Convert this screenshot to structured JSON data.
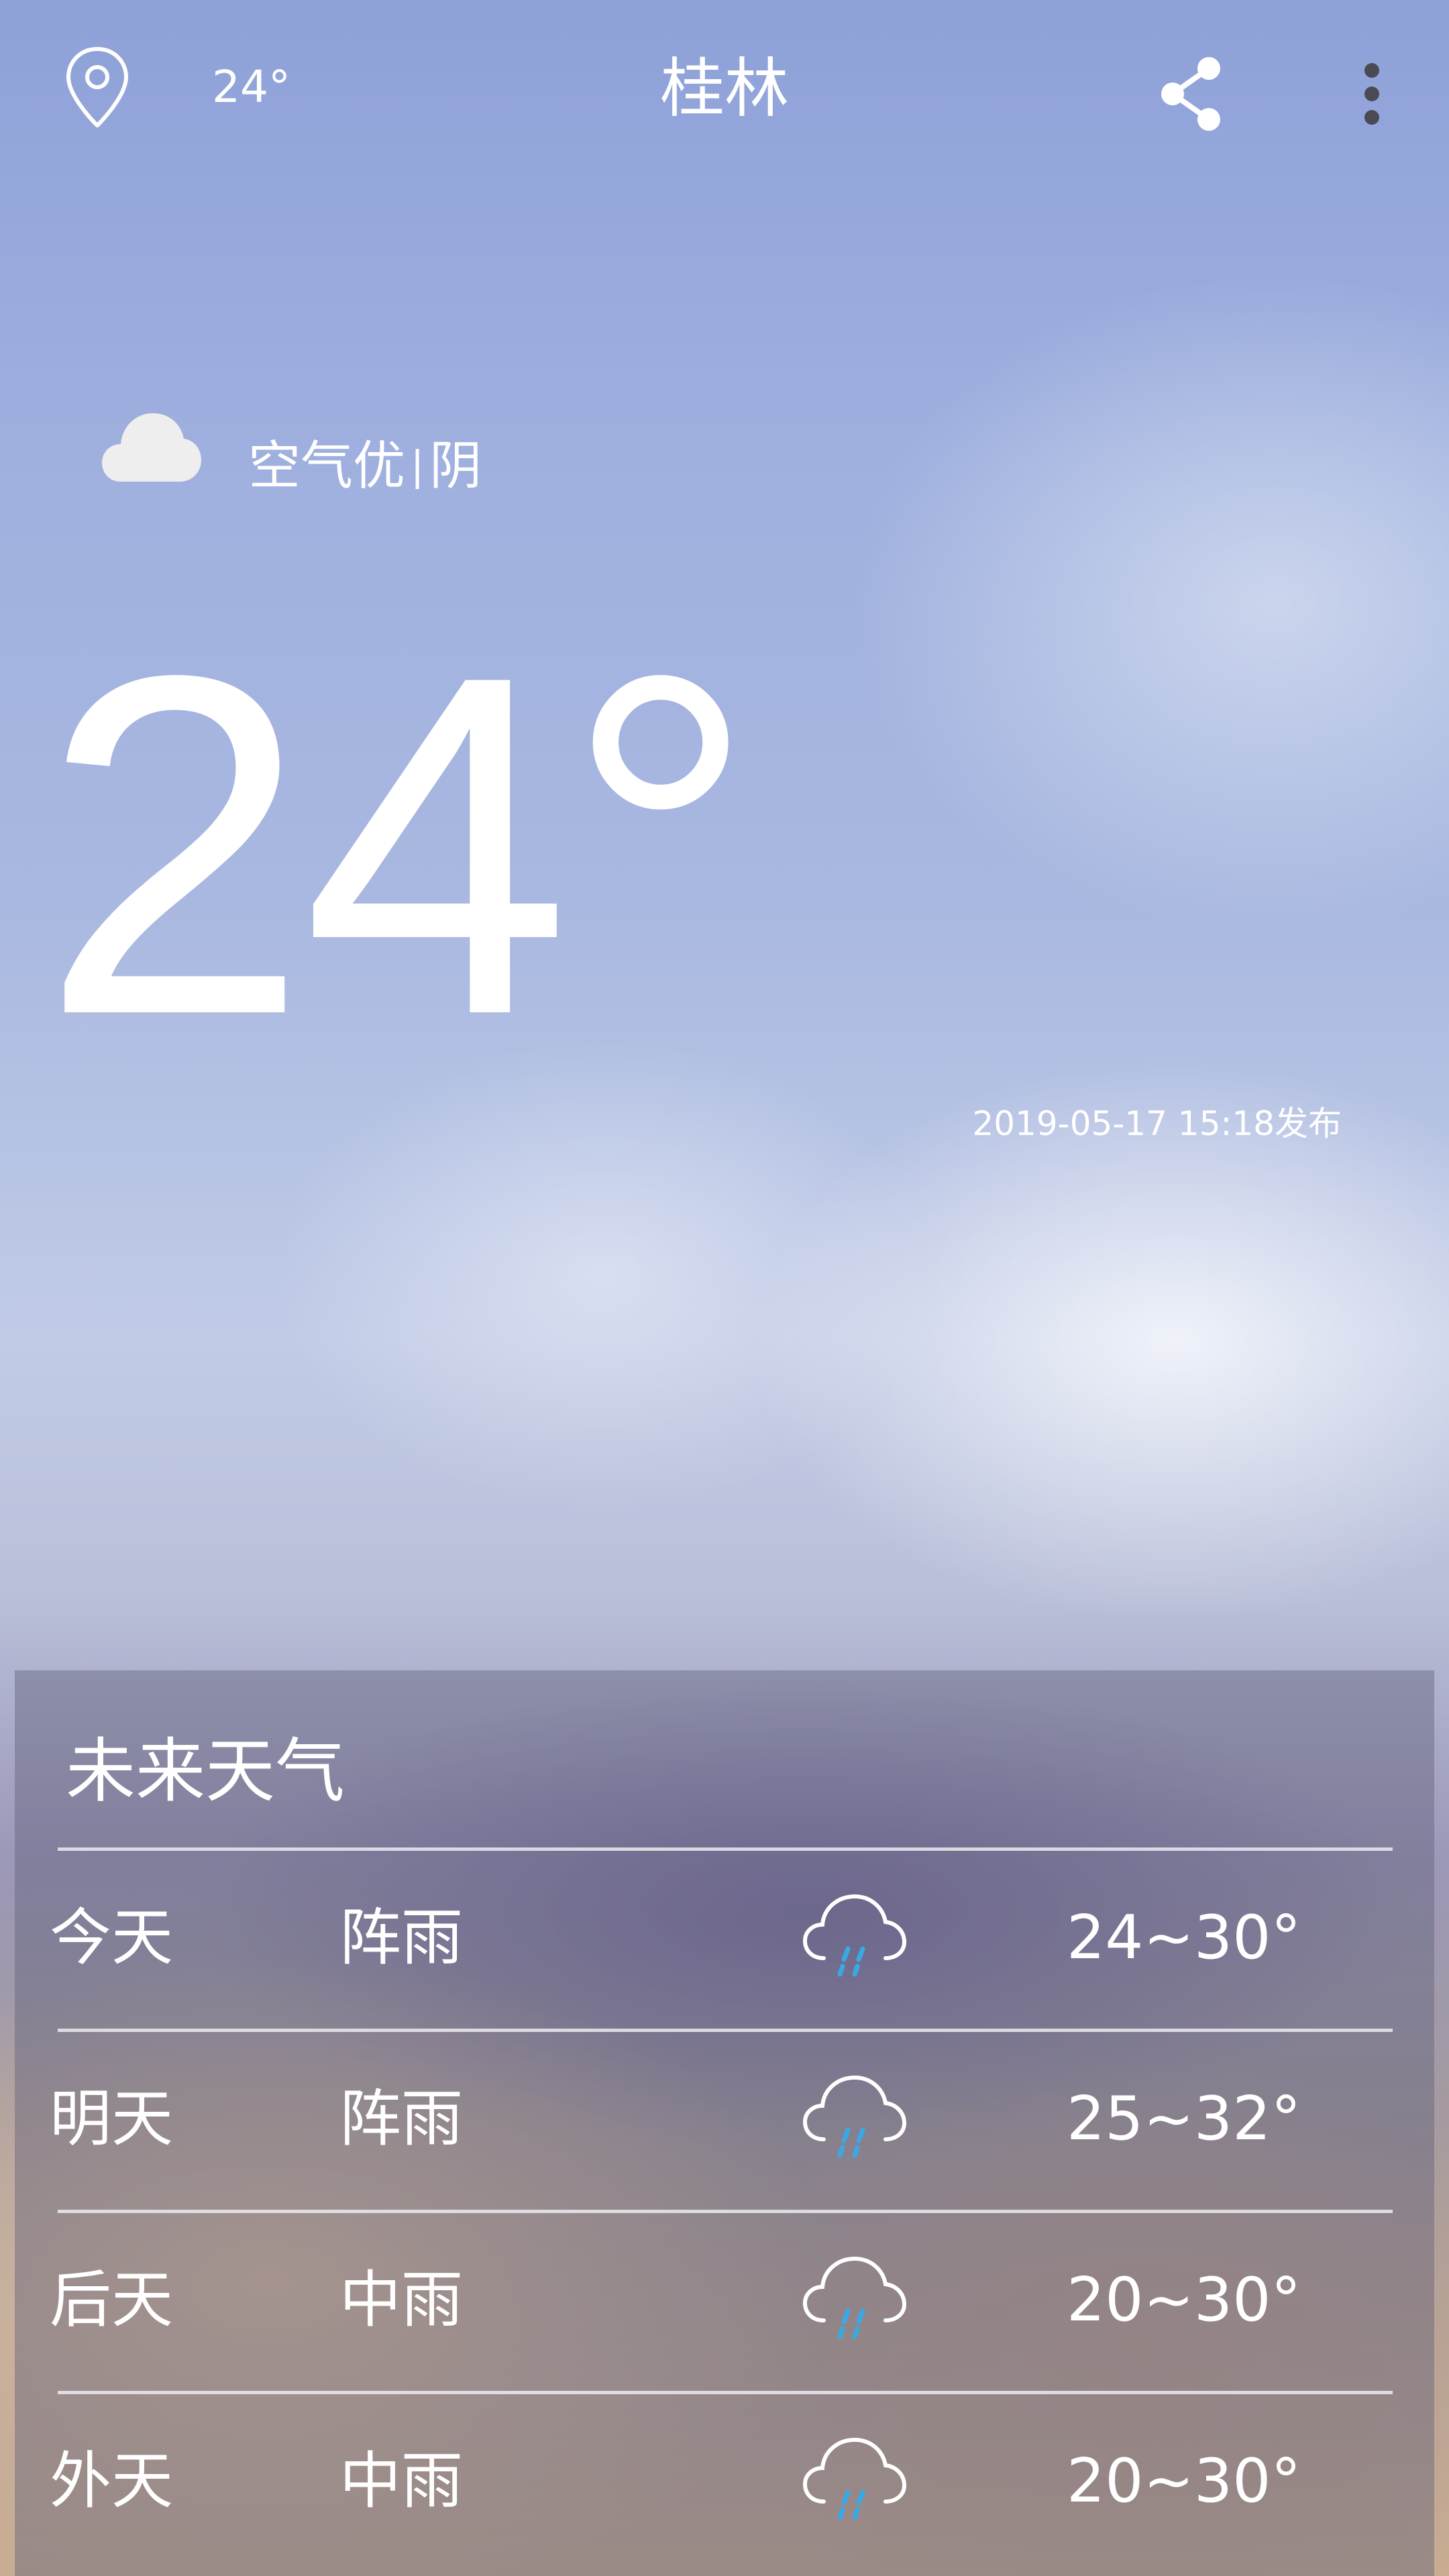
{
  "header": {
    "location_icon": "location-pin-icon",
    "current_temp": "24°",
    "city": "桂林",
    "share_icon": "share-icon",
    "more_icon": "more-vertical-icon"
  },
  "current": {
    "condition_icon": "cloud-icon",
    "air_quality": "空气优",
    "separator": "|",
    "weather": "阴",
    "temperature": "24°",
    "published": "2019-05-17 15:18发布"
  },
  "forecast": {
    "title": "未来天气",
    "days": [
      {
        "day": "今天",
        "condition": "阵雨",
        "icon": "rain-cloud-icon",
        "range": "24~30°"
      },
      {
        "day": "明天",
        "condition": "阵雨",
        "icon": "rain-cloud-icon",
        "range": "25~32°"
      },
      {
        "day": "后天",
        "condition": "中雨",
        "icon": "rain-cloud-icon",
        "range": "20~30°"
      },
      {
        "day": "外天",
        "condition": "中雨",
        "icon": "rain-cloud-icon",
        "range": "20~30°"
      }
    ]
  },
  "colors": {
    "text": "#ffffff",
    "rain_drops": "#39a9e6",
    "panel": "#5c5c78",
    "cloud_fill": "#eeeeee"
  }
}
